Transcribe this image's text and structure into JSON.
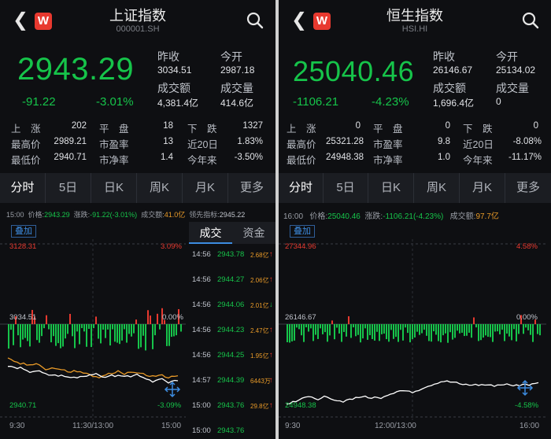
{
  "left": {
    "title": "上证指数",
    "code": "000001.SH",
    "price": "2943.29",
    "change": "-91.22",
    "change_pct": "-3.01%",
    "prev_close_label": "昨收",
    "prev_close": "3034.51",
    "open_label": "今开",
    "open": "2987.18",
    "turnover_label": "成交额",
    "turnover": "4,381.4亿",
    "volume_label": "成交量",
    "volume": "414.6亿",
    "stats": {
      "up_label": "上　涨",
      "up": "202",
      "flat_label": "平　盘",
      "flat": "18",
      "down_label": "下　跌",
      "down": "1327",
      "high_label": "最高价",
      "high": "2989.21",
      "pe_label": "市盈率",
      "pe": "13",
      "d20_label": "近20日",
      "d20": "1.83%",
      "low_label": "最低价",
      "low": "2940.71",
      "pb_label": "市净率",
      "pb": "1.4",
      "ytd_label": "今年来",
      "ytd": "-3.50%"
    },
    "tabs": [
      "分时",
      "5日",
      "日K",
      "周K",
      "月K",
      "更多"
    ],
    "header": {
      "time": "15:00",
      "price_label": "价格:",
      "price": "2943.29",
      "chg_label": "涨跌:",
      "chg": "-91.22(-3.01%)",
      "amt_label": "成交额:",
      "amt": "41.0亿",
      "lead_label": "领先指标:",
      "lead": "2945.22"
    },
    "overlay": "叠加",
    "axis": {
      "top_val": "3128.31",
      "top_pct": "3.09%",
      "mid_val": "3034.51",
      "mid_pct": "0.00%",
      "bot_val": "2940.71",
      "bot_pct": "-3.09%"
    },
    "time_labels": [
      "9:30",
      "11:30/13:00",
      "15:00"
    ],
    "trade_tabs": [
      "成交",
      "资金"
    ],
    "ticks": [
      {
        "time": "14:56",
        "price": "2943.78",
        "amt": "2.68亿",
        "dir": "up"
      },
      {
        "time": "14:56",
        "price": "2944.27",
        "amt": "2.06亿",
        "dir": "up"
      },
      {
        "time": "14:56",
        "price": "2944.06",
        "amt": "2.01亿",
        "dir": "down"
      },
      {
        "time": "14:56",
        "price": "2944.23",
        "amt": "2.47亿",
        "dir": "up"
      },
      {
        "time": "14:56",
        "price": "2944.25",
        "amt": "1.95亿",
        "dir": "up"
      },
      {
        "time": "14:57",
        "price": "2944.39",
        "amt": "6443万",
        "dir": "up"
      },
      {
        "time": "15:00",
        "price": "2943.76",
        "amt": "29.8亿",
        "dir": "up"
      },
      {
        "time": "15:00",
        "price": "2943.76",
        "amt": "",
        "dir": ""
      }
    ]
  },
  "right": {
    "title": "恒生指数",
    "code": "HSI.HI",
    "price": "25040.46",
    "change": "-1106.21",
    "change_pct": "-4.23%",
    "prev_close_label": "昨收",
    "prev_close": "26146.67",
    "open_label": "今开",
    "open": "25134.02",
    "turnover_label": "成交额",
    "turnover": "1,696.4亿",
    "volume_label": "成交量",
    "volume": "0",
    "stats": {
      "up_label": "上　涨",
      "up": "0",
      "flat_label": "平　盘",
      "flat": "0",
      "down_label": "下　跌",
      "down": "0",
      "high_label": "最高价",
      "high": "25321.28",
      "pe_label": "市盈率",
      "pe": "9.8",
      "d20_label": "近20日",
      "d20": "-8.08%",
      "low_label": "最低价",
      "low": "24948.38",
      "pb_label": "市净率",
      "pb": "1.0",
      "ytd_label": "今年来",
      "ytd": "-11.17%"
    },
    "tabs": [
      "分时",
      "5日",
      "日K",
      "周K",
      "月K",
      "更多"
    ],
    "header": {
      "time": "16:00",
      "price_label": "价格:",
      "price": "25040.46",
      "chg_label": "涨跌:",
      "chg": "-1106.21(-4.23%)",
      "amt_label": "成交额:",
      "amt": "97.7亿"
    },
    "overlay": "叠加",
    "axis": {
      "top_val": "27344.96",
      "top_pct": "4.58%",
      "mid_val": "26146.67",
      "mid_pct": "0.00%",
      "bot_val": "24948.38",
      "bot_pct": "-4.58%"
    },
    "time_labels": [
      "9:30",
      "12:00/13:00",
      "16:00"
    ]
  },
  "colors": {
    "up": "#e8392f",
    "down": "#16c44a",
    "line_price": "#ffffff",
    "line_avg": "#e89a28",
    "bg": "#0e0f12"
  }
}
